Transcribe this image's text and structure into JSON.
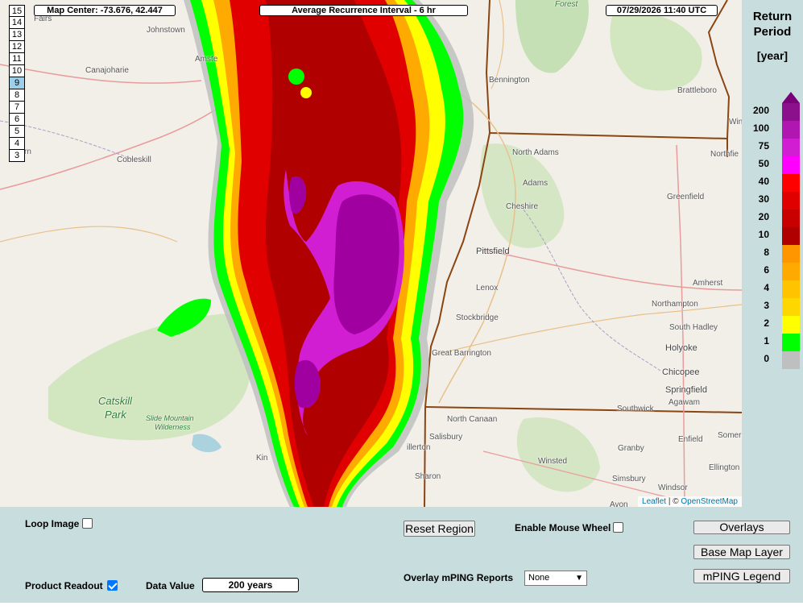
{
  "header": {
    "map_center": "Map Center: -73.676, 42.447",
    "product_title": "Average Recurrence Interval - 6 hr",
    "timestamp": "07/29/2026   11:40 UTC"
  },
  "zoom_levels": [
    "15",
    "14",
    "13",
    "12",
    "11",
    "10",
    "9",
    "8",
    "7",
    "6",
    "5",
    "4",
    "3"
  ],
  "active_zoom": "9",
  "places": {
    "johnstown": "Johnstown",
    "amsterdam": "Amste",
    "canajoharie": "Canajoharie",
    "cobleskill": "Cobleskill",
    "catskill_park_1": "Catskill",
    "catskill_park_2": "Park",
    "slide_mountain_1": "Slide Mountain",
    "slide_mountain_2": "Wilderness",
    "kingston": "Kin",
    "bennington": "Bennington",
    "forest": "Forest",
    "north_adams": "North Adams",
    "adams": "Adams",
    "cheshire": "Cheshire",
    "pittsfield": "Pittsfield",
    "lenox": "Lenox",
    "stockbridge": "Stockbridge",
    "great_barrington": "Great Barrington",
    "north_canaan": "North Canaan",
    "salisbury": "Salisbury",
    "millerton": "illerton",
    "sharon": "Sharon",
    "winsted": "Winsted",
    "granby": "Granby",
    "simsbury": "Simsbury",
    "avon": "Avon",
    "windsor": "Windsor",
    "southwick": "Southwick",
    "agawam": "Agawam",
    "springfield": "Springfield",
    "chicopee": "Chicopee",
    "holyoke": "Holyoke",
    "south_hadley": "South Hadley",
    "northampton": "Northampton",
    "amherst": "Amherst",
    "greenfield": "Greenfield",
    "brattleboro": "Brattleboro",
    "northfield": "Northfie",
    "enfield": "Enfield",
    "somers": "Somer",
    "ellington": "Ellington",
    "fairs": "Fairs",
    "win": "Win",
    "rn": "rn"
  },
  "attribution": {
    "leaflet": "Leaflet",
    "separator": " | © ",
    "osm": "OpenStreetMap"
  },
  "legend": {
    "title_line1": "Return",
    "title_line2": "Period",
    "unit": "[year]",
    "ticks": [
      "200",
      "100",
      "75",
      "50",
      "40",
      "30",
      "20",
      "10",
      "8",
      "6",
      "4",
      "3",
      "2",
      "1",
      "0"
    ],
    "colors": [
      "#8c0f8c",
      "#b017b0",
      "#d21ed2",
      "#ff00ff",
      "#ff0000",
      "#e00000",
      "#c80000",
      "#b00000",
      "#ff9600",
      "#ffaa00",
      "#ffc300",
      "#ffd700",
      "#ffff00",
      "#00ff00",
      "#bfbfbf"
    ],
    "top_arrow_color": "#7a007a"
  },
  "controls": {
    "loop_image_label": "Loop Image",
    "loop_image_checked": false,
    "product_readout_label": "Product Readout",
    "product_readout_checked": true,
    "data_value_label": "Data Value",
    "data_value": "200 years",
    "reset_region_label": "Reset Region",
    "enable_mouse_wheel_label": "Enable Mouse Wheel",
    "enable_mouse_wheel_checked": false,
    "overlay_mping_label": "Overlay mPING Reports",
    "overlay_mping_selected": "None",
    "overlays_label": "Overlays",
    "base_map_layer_label": "Base Map Layer",
    "mping_legend_label": "mPING Legend"
  }
}
